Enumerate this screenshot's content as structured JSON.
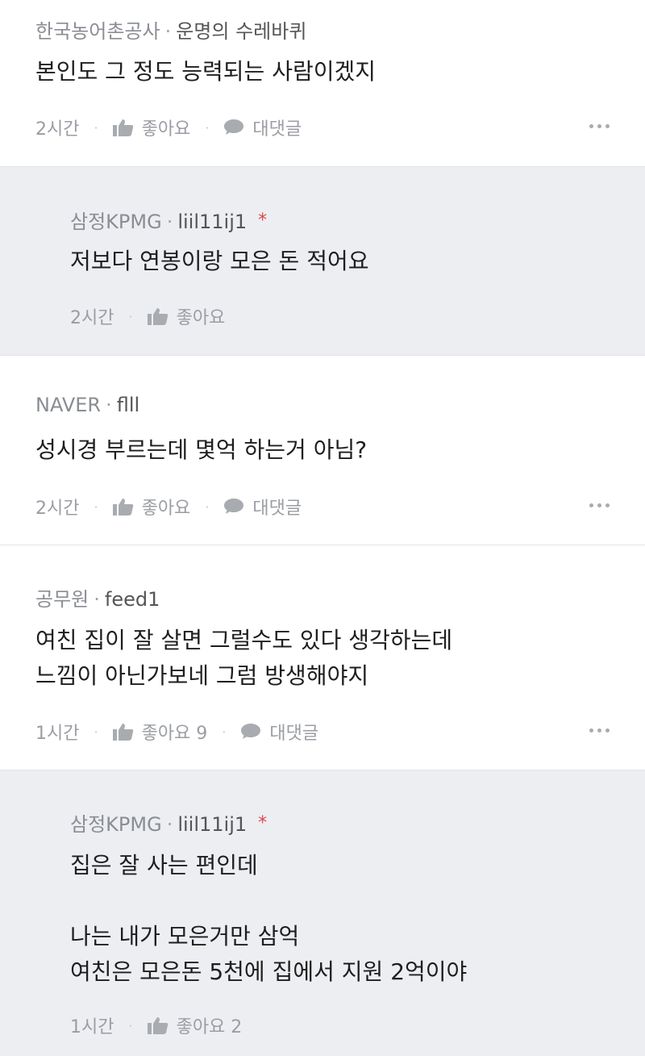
{
  "comments": [
    {
      "org": "한국농어촌공사",
      "author": "운명의 수레바퀴",
      "lines": [
        "본인도 그 정도 능력되는 사람이겠지"
      ],
      "time": "2시간",
      "like_label": "좋아요",
      "reply_label": "대댓글"
    },
    {
      "org": "삼정KPMG",
      "author": "liil11ij1",
      "mark": "*",
      "lines": [
        "저보다 연봉이랑 모은 돈 적어요"
      ],
      "time": "2시간",
      "like_label": "좋아요"
    },
    {
      "org": "NAVER",
      "author": "flll",
      "lines": [
        "성시경 부르는데 몇억 하는거 아님?"
      ],
      "time": "2시간",
      "like_label": "좋아요",
      "reply_label": "대댓글"
    },
    {
      "org": "공무원",
      "author": "feed1",
      "lines": [
        "여친 집이 잘 살면 그럴수도 있다 생각하는데",
        "느낌이 아닌가보네 그럼 방생해야지"
      ],
      "time": "1시간",
      "like_label": "좋아요 9",
      "reply_label": "대댓글"
    },
    {
      "org": "삼정KPMG",
      "author": "liil11ij1",
      "mark": "*",
      "lines": [
        "집은 잘 사는 편인데",
        "",
        "나는 내가 모은거만 삼억",
        "여친은 모은돈 5천에 집에서 지원 2억이야"
      ],
      "time": "1시간",
      "like_label": "좋아요 2"
    }
  ],
  "icons": {
    "like": "thumbs-up-icon",
    "reply": "speech-bubble-icon",
    "more": "more-dots-icon"
  },
  "colors": {
    "reply_bg": "#eceef2",
    "author_mark": "#e0464b",
    "divider": "#e3e4e8"
  }
}
